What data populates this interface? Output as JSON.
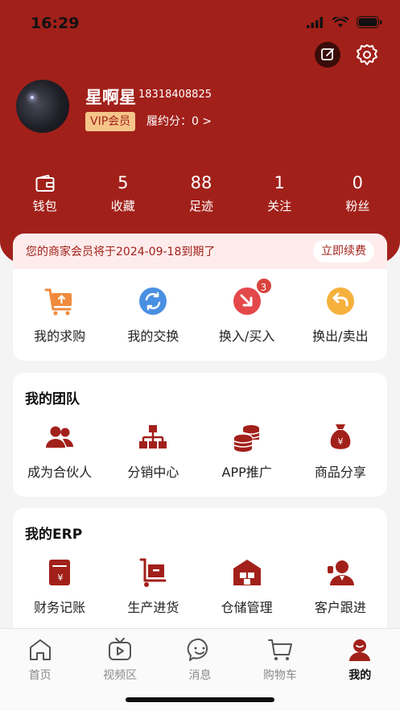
{
  "status_bar": {
    "time": "16:29"
  },
  "profile": {
    "name": "星啊星",
    "phone": "18318408825",
    "vip_label": "VIP会员",
    "credit_label": "履约分：0 >"
  },
  "stats": [
    {
      "value": "",
      "label": "钱包",
      "icon": "wallet-icon"
    },
    {
      "value": "5",
      "label": "收藏"
    },
    {
      "value": "88",
      "label": "足迹"
    },
    {
      "value": "1",
      "label": "关注"
    },
    {
      "value": "0",
      "label": "粉丝"
    }
  ],
  "notice": {
    "text": "您的商家会员将于2024-09-18到期了",
    "button": "立即续费"
  },
  "actions": [
    {
      "label": "我的求购",
      "icon": "cart-upload-icon"
    },
    {
      "label": "我的交换",
      "icon": "exchange-icon"
    },
    {
      "label": "换入/买入",
      "icon": "swap-in-icon",
      "badge": "3"
    },
    {
      "label": "换出/卖出",
      "icon": "swap-out-icon"
    }
  ],
  "team": {
    "title": "我的团队",
    "items": [
      {
        "label": "成为合伙人",
        "icon": "partner-icon"
      },
      {
        "label": "分销中心",
        "icon": "distribution-icon"
      },
      {
        "label": "APP推广",
        "icon": "coins-icon"
      },
      {
        "label": "商品分享",
        "icon": "money-bag-icon"
      }
    ]
  },
  "erp": {
    "title": "我的ERP",
    "items": [
      {
        "label": "财务记账",
        "icon": "ledger-icon"
      },
      {
        "label": "生产进货",
        "icon": "trolley-icon"
      },
      {
        "label": "仓储管理",
        "icon": "warehouse-icon"
      },
      {
        "label": "客户跟进",
        "icon": "customer-icon"
      }
    ]
  },
  "tabbar": [
    {
      "label": "首页",
      "icon": "home-icon"
    },
    {
      "label": "视频区",
      "icon": "tv-icon"
    },
    {
      "label": "消息",
      "icon": "chat-icon"
    },
    {
      "label": "购物车",
      "icon": "cart-icon"
    },
    {
      "label": "我的",
      "icon": "profile-icon",
      "active": true
    }
  ],
  "colors": {
    "brand": "#a2201a",
    "vip_bg": "#f6c58a",
    "notice_bg": "#fdeceb"
  }
}
